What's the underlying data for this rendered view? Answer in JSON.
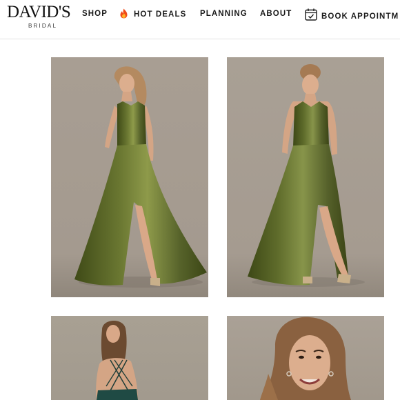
{
  "brand": {
    "name": "DAVID'S",
    "sub": "BRIDAL"
  },
  "nav": {
    "shop": "SHOP",
    "hot_deals": "HOT DEALS",
    "planning": "PLANNING",
    "about": "ABOUT",
    "book": "BOOK APPOINTM"
  },
  "icons": {
    "hot_deals": "fire-icon",
    "book": "calendar-icon"
  },
  "colors": {
    "backdrop": "#a79d92",
    "dress": "#556126",
    "dress_highlight": "#8e9a4a",
    "skin": "#d9a888",
    "hair": "#a57a53",
    "teal_dress": "#1f4a44",
    "header_text": "#1a1a1a"
  },
  "products": [
    {
      "image": "olive-satin-gown-front"
    },
    {
      "image": "olive-satin-gown-front-alt"
    },
    {
      "image": "teal-gown-back-crisscross"
    },
    {
      "image": "model-closeup-earrings"
    }
  ]
}
